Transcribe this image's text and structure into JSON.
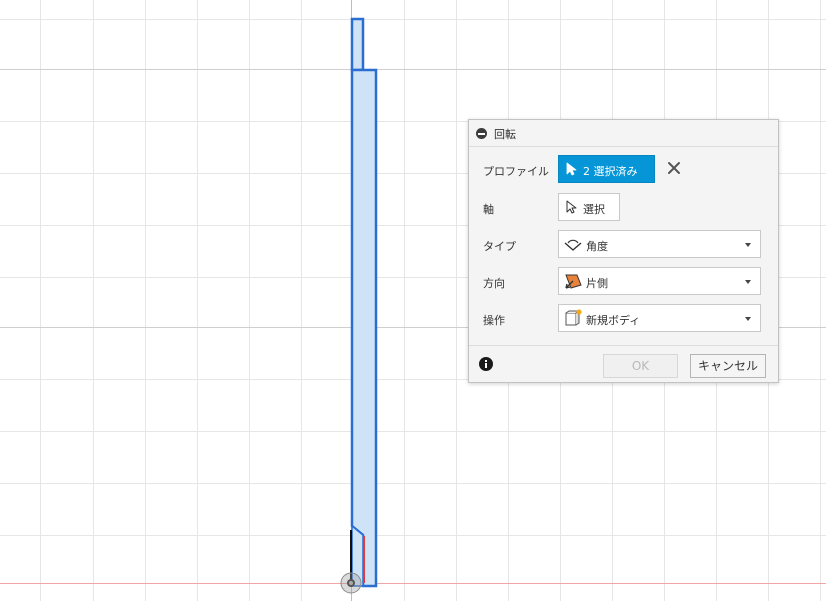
{
  "dialog": {
    "title": "回転",
    "profile": {
      "label": "プロファイル",
      "button_label": "2 選択済み"
    },
    "axis": {
      "label": "軸",
      "button_label": "選択"
    },
    "type": {
      "label": "タイプ",
      "value": "角度"
    },
    "direction": {
      "label": "方向",
      "value": "片側"
    },
    "operation": {
      "label": "操作",
      "value": "新規ボディ"
    },
    "ok_label": "OK",
    "cancel_label": "キャンセル"
  },
  "colors": {
    "accent": "#0696d7",
    "sketch_fill": "#cfe3f7",
    "sketch_stroke": "#2a6ed4",
    "red_axis": "#e06b6b",
    "grid": "#e6e6e6"
  },
  "icons": {
    "collapse": "collapse-icon",
    "cursor": "cursor-arrow-icon",
    "clear": "close-icon",
    "angle": "angle-type-icon",
    "direction": "one-side-direction-icon",
    "new_body": "new-body-icon",
    "info": "info-icon",
    "origin": "origin-point-icon"
  }
}
